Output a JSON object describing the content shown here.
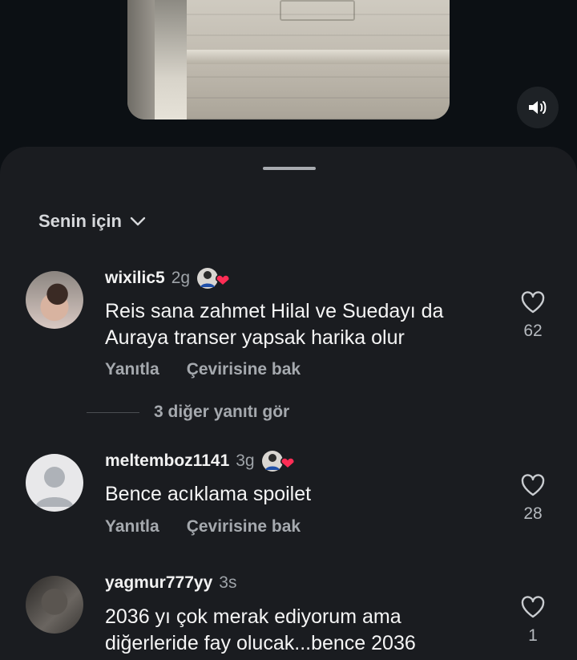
{
  "sort": {
    "label": "Senin için"
  },
  "view_more": {
    "label": "3 diğer yanıtı gör"
  },
  "comments": [
    {
      "username": "wixilic5",
      "time": "2g",
      "text": "Reis sana zahmet Hilal ve Suedayı da Auraya transer yapsak harika olur",
      "reply": "Yanıtla",
      "translate": "Çevirisine bak",
      "likes": "62"
    },
    {
      "username": "meltemboz1141",
      "time": "3g",
      "text": "Bence acıklama spoilet",
      "reply": "Yanıtla",
      "translate": "Çevirisine bak",
      "likes": "28"
    },
    {
      "username": "yagmur777yy",
      "time": "3s",
      "text": "2036 yı çok merak ediyorum ama diğerleride fay olucak...bence 2036",
      "likes": "1"
    }
  ],
  "colors": {
    "sheet": "#1a1c20",
    "background": "#0c1014",
    "heart_badge": "#ff2d55"
  }
}
